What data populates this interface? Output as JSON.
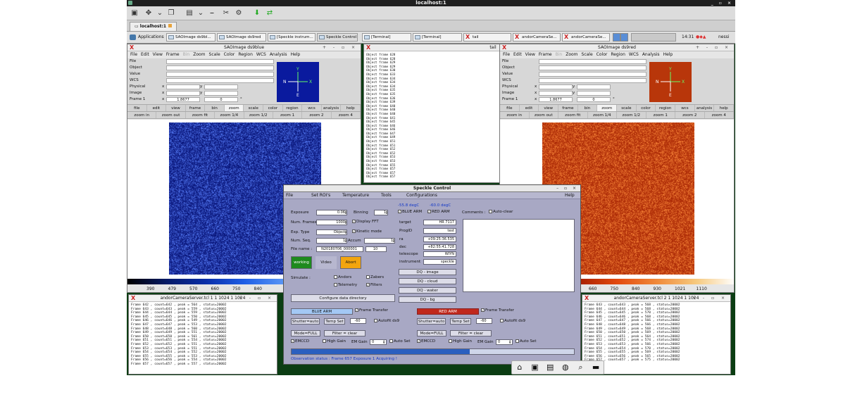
{
  "vnc": {
    "title": "localhost:1",
    "tab": "localhost:1"
  },
  "taskbar": {
    "apps": "Applications",
    "items": [
      "SAOImage ds9bl...",
      "SAOImage ds9red",
      "[Speckle instrum...",
      "Speckle Control",
      "[Terminal]",
      "[Terminal]",
      "tail",
      "andorCameraSe...",
      "andorCameraSe..."
    ],
    "clock": "14:31",
    "user": "nessi"
  },
  "ds9blue": {
    "title": "SAOImage ds9blue",
    "menu": [
      "File",
      "Edit",
      "View",
      "Frame",
      "Bin",
      "Zoom",
      "Scale",
      "Color",
      "Region",
      "WCS",
      "Analysis",
      "Help"
    ],
    "info": {
      "labels": [
        "File",
        "Object",
        "Value",
        "WCS",
        "Physical",
        "Image",
        "Frame 1"
      ],
      "x": "x",
      "y": "y",
      "frame_val1": "1.8677",
      "frame_val2": "0",
      "deg": "°"
    },
    "buttons1": [
      "file",
      "edit",
      "view",
      "frame",
      "bin",
      "zoom",
      "scale",
      "color",
      "region",
      "wcs",
      "analysis",
      "help"
    ],
    "buttons2": [
      "zoom in",
      "zoom out",
      "zoom fit",
      "zoom 1/4",
      "zoom 1/2",
      "zoom 1",
      "zoom 2",
      "zoom 4"
    ],
    "ticks": [
      "390",
      "479",
      "570",
      "660",
      "750",
      "840"
    ],
    "compass": {
      "n": "N",
      "e": "E",
      "x": "X",
      "y": "Y"
    },
    "colors": {
      "img": "#0d2fb0"
    }
  },
  "ds9red": {
    "title": "SAOImage ds9red",
    "menu": [
      "File",
      "Edit",
      "View",
      "Frame",
      "Bin",
      "Zoom",
      "Scale",
      "Color",
      "Region",
      "WCS",
      "Analysis",
      "Help"
    ],
    "info": {
      "labels": [
        "File",
        "Object",
        "Value",
        "WCS",
        "Physical",
        "Image",
        "Frame 1"
      ],
      "x": "x",
      "y": "y",
      "frame_val1": "1.8677",
      "frame_val2": "0",
      "deg": "°"
    },
    "buttons1": [
      "file",
      "edit",
      "view",
      "frame",
      "bin",
      "zoom",
      "scale",
      "color",
      "region",
      "wcs",
      "analysis",
      "help"
    ],
    "buttons2": [
      "zoom in",
      "zoom out",
      "zoom fit",
      "zoom 1/4",
      "zoom 1/2",
      "zoom 1",
      "zoom 2",
      "zoom 4"
    ],
    "ticks": [
      "660",
      "750",
      "840",
      "930",
      "1021",
      "1110"
    ],
    "compass": {
      "n": "N",
      "e": "E",
      "x": "X",
      "y": "Y"
    },
    "colors": {
      "img": "#c8400a"
    }
  },
  "tail": {
    "title": "tail",
    "lines": [
      "Object frame 628",
      "Object frame 628",
      "Object frame 629",
      "Object frame 629",
      "Object frame 630",
      "Object frame 633",
      "Object frame 634",
      "Object frame 634",
      "Object frame 634",
      "Object frame 635",
      "Object frame 635",
      "Object frame 636",
      "Object frame 639",
      "Object frame 640",
      "Object frame 640",
      "Object frame 640",
      "Object frame 641",
      "Object frame 645",
      "Object frame 646",
      "Object frame 646",
      "Object frame 647",
      "Object frame 649",
      "Object frame 651",
      "Object frame 651",
      "Object frame 652",
      "Object frame 652",
      "Object frame 653",
      "Object frame 653",
      "Object frame 655",
      "Object frame 657",
      "Object frame 657",
      "Object frame 657"
    ]
  },
  "term_left": {
    "title": "andorCameraServer.tcl 1 1 1024 1 1024",
    "lines": [
      "Frame 642 , count=642 , peak = 564 , status=20002",
      "Frame 643 , count=643 , peak = 559 , status=20002",
      "Frame 644 , count=644 , peak = 559 , status=20002",
      "Frame 645 , count=645 , peak = 550 , status=20002",
      "Frame 646 , count=646 , peak = 549 , status=20002",
      "Frame 647 , count=647 , peak = 553 , status=20002",
      "Frame 648 , count=648 , peak = 560 , status=20002",
      "Frame 649 , count=649 , peak = 551 , status=20002",
      "Frame 650 , count=650 , peak = 561 , status=20002",
      "Frame 651 , count=651 , peak = 554 , status=20002",
      "Frame 652 , count=652 , peak = 551 , status=20002",
      "Frame 653 , count=653 , peak = 551 , status=20002",
      "Frame 654 , count=654 , peak = 552 , status=20002",
      "Frame 655 , count=655 , peak = 553 , status=20002",
      "Frame 656 , count=656 , peak = 554 , status=20002",
      "Frame 657 , count=657 , peak = 557 , status=20002"
    ]
  },
  "term_right": {
    "title": "andorCameraServer.tcl 2 1 1024 1 1024",
    "lines": [
      "Frame 643 , count=643 , peak = 568 , status=20002",
      "Frame 644 , count=644 , peak = 568 , status=20002",
      "Frame 645 , count=645 , peak = 570 , status=20002",
      "Frame 646 , count=646 , peak = 568 , status=20002",
      "Frame 647 , count=647 , peak = 566 , status=20002",
      "Frame 648 , count=648 , peak = 566 , status=20002",
      "Frame 649 , count=649 , peak = 568 , status=20002",
      "Frame 650 , count=650 , peak = 569 , status=20002",
      "Frame 651 , count=651 , peak = 564 , status=20002",
      "Frame 652 , count=652 , peak = 574 , status=20002",
      "Frame 653 , count=653 , peak = 566 , status=20002",
      "Frame 654 , count=654 , peak = 570 , status=20002",
      "Frame 655 , count=655 , peak = 569 , status=20002",
      "Frame 656 , count=656 , peak = 565 , status=20002",
      "Frame 657 , count=657 , peak = 575 , status=20002"
    ]
  },
  "speckle": {
    "title": "Speckle Control",
    "menu": [
      "File",
      "Set ROI's",
      "Temperature",
      "Tools",
      "Configurations",
      "Help"
    ],
    "temps": {
      "blue": "-55.8 degC",
      "red": "-60.0 degC"
    },
    "exposure": {
      "label": "Exposure",
      "value": "0.06"
    },
    "binning": {
      "label": "Binning",
      "value": "1"
    },
    "num_frames": {
      "label": "Num. Frames",
      "value": "1000"
    },
    "display_fft": "Display FFT",
    "exp_type": {
      "label": "Exp. Type",
      "value": "Object"
    },
    "kinetic": "Kinetic mode",
    "num_seq": {
      "label": "Num. Seq.",
      "value": "1"
    },
    "accum": {
      "label": "Accum",
      "value": "1"
    },
    "file_name": {
      "label": "File name :",
      "value": "N20180706_000001",
      "num": "10"
    },
    "working": "working",
    "video": "Video",
    "abort": "Abort",
    "arms": {
      "blue": "BLUE ARM",
      "red": "RED ARM"
    },
    "comments": "Comments :",
    "auto_clear": "Auto-clear",
    "target": {
      "label": "target",
      "value": "HR 7117"
    },
    "progid": {
      "label": "ProgID",
      "value": "test"
    },
    "ra": {
      "label": "ra",
      "value": "+09:25:36.535"
    },
    "dec": {
      "label": "dec",
      "value": "+82:55:41.728"
    },
    "telescope": {
      "label": "telescope",
      "value": "WIYN"
    },
    "instrument": {
      "label": "instrument",
      "value": "speckle"
    },
    "dq": [
      "DQ - image",
      "DQ - cloud",
      "DQ - water",
      "DQ - bg"
    ],
    "simulate": "Simulate :",
    "sim": [
      "Andors",
      "Zabers",
      "Telemetry",
      "Filters"
    ],
    "config_dir": "Configure data directory",
    "frame_transfer": "Frame Transfer",
    "shutter": "Shutter=auto",
    "temp_set": "Temp Set",
    "temp_val": "-60",
    "autofit": "Autofit ds9",
    "mode": "Mode=FULL",
    "filter": "Filter = clear",
    "emccd": "EMCCD",
    "high_gain": "High Gain",
    "em_gain": "EM Gain",
    "em_val": "0",
    "auto_set": "Auto Set",
    "progress": 0.63,
    "status": "Observation status : Frame 657   Exposure 1  Acquiring !",
    "colors": {
      "blue_arm": "#a3c8f5",
      "red_arm": "#c0281c",
      "working": "#1e8a1e",
      "abort": "#f2a50f"
    }
  }
}
